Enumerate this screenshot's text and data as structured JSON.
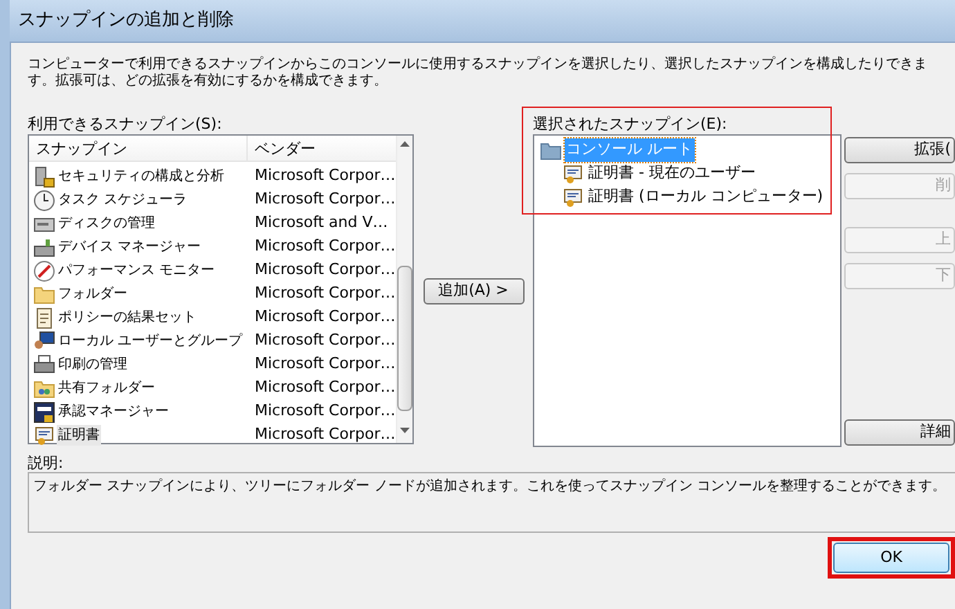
{
  "window": {
    "title": "スナップインの追加と削除"
  },
  "intro": "コンピューターで利用できるスナップインからこのコンソールに使用するスナップインを選択したり、選択したスナップインを構成したりできます。拡張可は、どの拡張を有効にするかを構成できます。",
  "available": {
    "label": "利用できるスナップイン(S):",
    "columns": [
      "スナップイン",
      "ベンダー"
    ],
    "rows": [
      {
        "name": "セキュリティの構成と分析",
        "vendor": "Microsoft Corpor…",
        "selected": false
      },
      {
        "name": "タスク スケジューラ",
        "vendor": "Microsoft Corpor…",
        "selected": false
      },
      {
        "name": "ディスクの管理",
        "vendor": "Microsoft and V…",
        "selected": false
      },
      {
        "name": "デバイス マネージャー",
        "vendor": "Microsoft Corpor…",
        "selected": false
      },
      {
        "name": "パフォーマンス モニター",
        "vendor": "Microsoft Corpor…",
        "selected": false
      },
      {
        "name": "フォルダー",
        "vendor": "Microsoft Corpor…",
        "selected": false
      },
      {
        "name": "ポリシーの結果セット",
        "vendor": "Microsoft Corpor…",
        "selected": false
      },
      {
        "name": "ローカル ユーザーとグループ",
        "vendor": "Microsoft Corpor…",
        "selected": false
      },
      {
        "name": "印刷の管理",
        "vendor": "Microsoft Corpor…",
        "selected": false
      },
      {
        "name": "共有フォルダー",
        "vendor": "Microsoft Corpor…",
        "selected": false
      },
      {
        "name": "承認マネージャー",
        "vendor": "Microsoft Corpor…",
        "selected": false
      },
      {
        "name": "証明書",
        "vendor": "Microsoft Corpor…",
        "selected": true
      }
    ]
  },
  "add_button": "追加(A) >",
  "selected_snapins": {
    "label": "選択されたスナップイン(E):",
    "tree": [
      {
        "label": "コンソール ルート",
        "selected": true,
        "children": [
          {
            "label": "証明書 - 現在のユーザー",
            "selected": false
          },
          {
            "label": "証明書 (ローカル コンピューター)",
            "selected": false
          }
        ]
      }
    ]
  },
  "side_buttons": [
    {
      "label": "拡張(",
      "disabled": false
    },
    {
      "label": "削",
      "disabled": true
    },
    {
      "label": "上",
      "disabled": true
    },
    {
      "label": "下",
      "disabled": true
    },
    {
      "label": "詳細",
      "disabled": false
    }
  ],
  "description": {
    "label": "説明:",
    "text": "フォルダー スナップインにより、ツリーにフォルダー ノードが追加されます。これを使ってスナップイン コンソールを整理することができます。"
  },
  "ok_button": "OK"
}
